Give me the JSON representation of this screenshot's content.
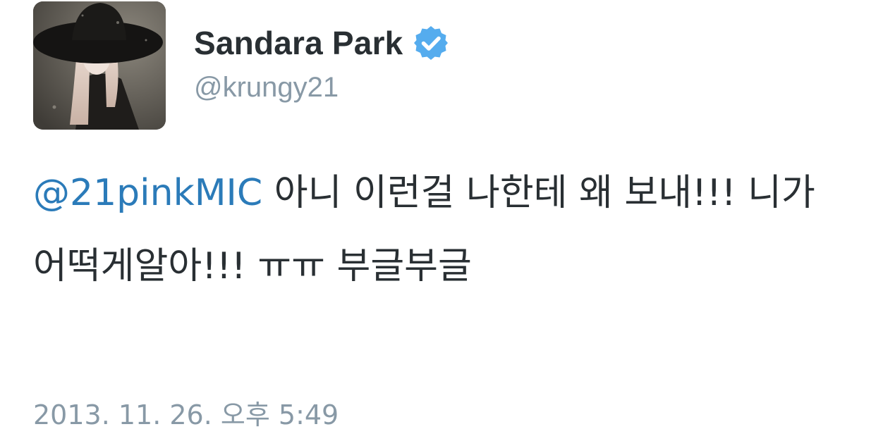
{
  "user": {
    "display_name": "Sandara Park",
    "handle": "@krungy21",
    "verified": true,
    "avatar_icon": "profile-photo"
  },
  "tweet": {
    "mention": "@21pinkMIC",
    "body": " 아니 이런걸 나한테 왜 보내!!! 니가 어떡게알아!!! ㅠㅠ 부글부글"
  },
  "meta": {
    "timestamp": "2013. 11. 26. 오후 5:49"
  },
  "colors": {
    "link": "#2b7bb9",
    "text": "#292f33",
    "muted": "#8899a6",
    "verified_badge": "#55acee"
  }
}
